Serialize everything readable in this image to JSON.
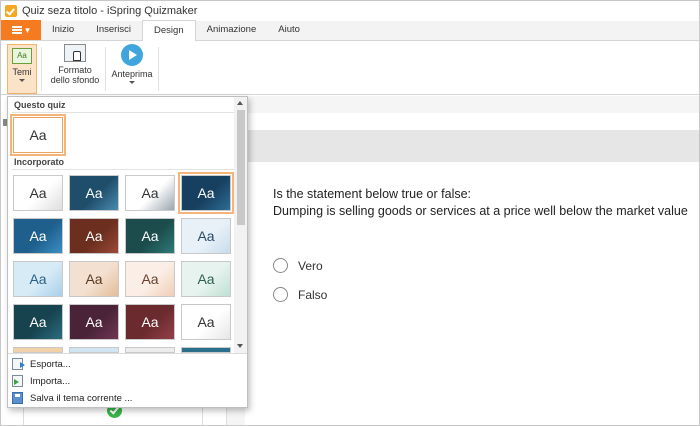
{
  "window": {
    "title": "Quiz seza titolo - iSpring Quizmaker"
  },
  "tabs": [
    "Inizio",
    "Inserisci",
    "Design",
    "Animazione",
    "Aiuto"
  ],
  "active_tab": "Design",
  "ribbon": {
    "temi_label": "Temi",
    "formato_label_1": "Formato",
    "formato_label_2": "dello sfondo",
    "anteprima_label": "Anteprima"
  },
  "themes_panel": {
    "section_current": "Questo quiz",
    "section_builtin": "Incorporato",
    "sample_text": "Aa",
    "themes": [
      {
        "bg": "#ffffff",
        "fg": "#333333",
        "accent": "#dddddd"
      },
      {
        "bg": "#1f4e6b",
        "fg": "#ffffff",
        "accent": "#4a8bb0"
      },
      {
        "bg": "#ffffff",
        "fg": "#333333",
        "accent": "#9aa5b0"
      },
      {
        "bg": "#173f5f",
        "fg": "#ffffff",
        "accent": "#2e6d96"
      },
      {
        "bg": "#1e5f8c",
        "fg": "#ffffff",
        "accent": "#3b8ec4"
      },
      {
        "bg": "#6b2e1f",
        "fg": "#ffffff",
        "accent": "#9a4a36"
      },
      {
        "bg": "#1c4c4c",
        "fg": "#ffffff",
        "accent": "#2d7a78"
      },
      {
        "bg": "#e8f1f8",
        "fg": "#2a4a66",
        "accent": "#c7dcec"
      },
      {
        "bg": "#d7ebf7",
        "fg": "#2a5f86",
        "accent": "#a8d0ea"
      },
      {
        "bg": "#f3e0d0",
        "fg": "#5a3a22",
        "accent": "#e3bc98"
      },
      {
        "bg": "#fbeee6",
        "fg": "#6b4030",
        "accent": "#f0cdb6"
      },
      {
        "bg": "#e6f3ee",
        "fg": "#2f6150",
        "accent": "#bfe0d3"
      },
      {
        "bg": "#17434f",
        "fg": "#ffffff",
        "accent": "#2b6d80"
      },
      {
        "bg": "#4a2338",
        "fg": "#ffffff",
        "accent": "#703653"
      },
      {
        "bg": "#6a2a2e",
        "fg": "#ffffff",
        "accent": "#934048"
      },
      {
        "bg": "#ffffff",
        "fg": "#333333",
        "accent": "#e6e6e6"
      }
    ],
    "partial_row": [
      {
        "bg": "#f1d2a8"
      },
      {
        "bg": "#d0e4f1"
      },
      {
        "bg": "#ececec"
      },
      {
        "bg": "#2a6f8c"
      }
    ],
    "menu": {
      "export": "Esporta...",
      "import": "Importa...",
      "save": "Salva il tema corrente ..."
    }
  },
  "question": {
    "line1": "Is the statement below true or false:",
    "line2": "Dumping is selling goods or services at a price well below the market value",
    "options": [
      "Vero",
      "Falso"
    ]
  }
}
